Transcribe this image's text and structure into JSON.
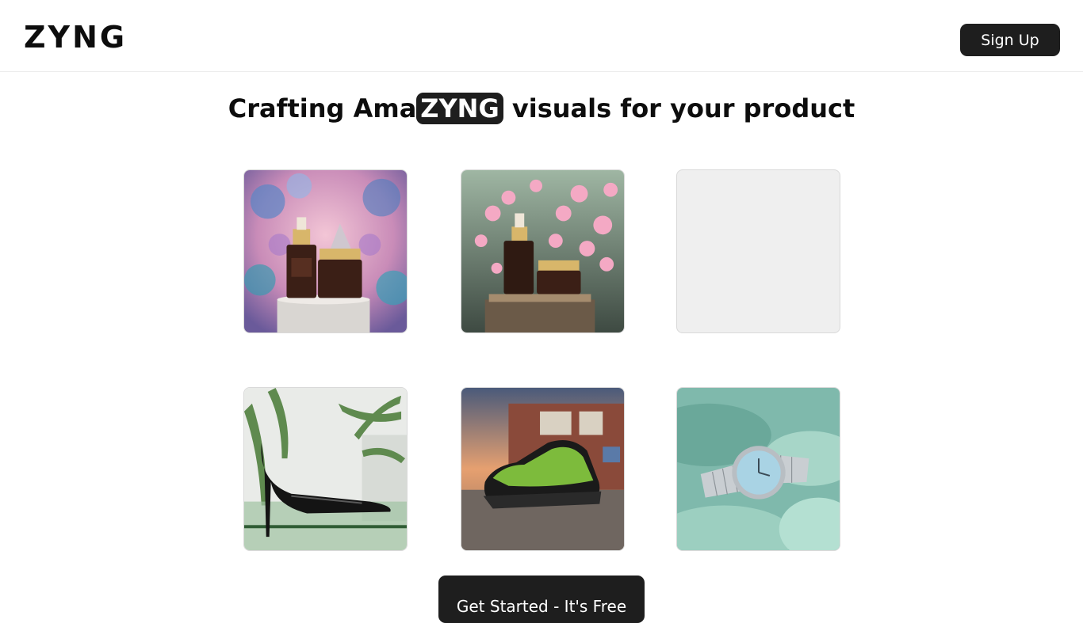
{
  "brand": {
    "logo_text": "ZYNG"
  },
  "header": {
    "signup_label": "Sign Up"
  },
  "hero": {
    "title_before": "Crafting Ama",
    "title_highlight": "ZYNG",
    "title_after": " visuals for your product"
  },
  "gallery": {
    "tiles": [
      {
        "subject": "skincare bottles on marble pedestal with crystals"
      },
      {
        "subject": "skincare bottles with pink blossoms"
      },
      {
        "subject": "loading placeholder"
      },
      {
        "subject": "black patent high heel with plants"
      },
      {
        "subject": "green and black sneaker on street"
      },
      {
        "subject": "silver wristwatch on mint background"
      }
    ]
  },
  "cta": {
    "label": "Get Started - It's Free"
  },
  "colors": {
    "accent_dark": "#1e1e1e",
    "background": "#ffffff"
  }
}
